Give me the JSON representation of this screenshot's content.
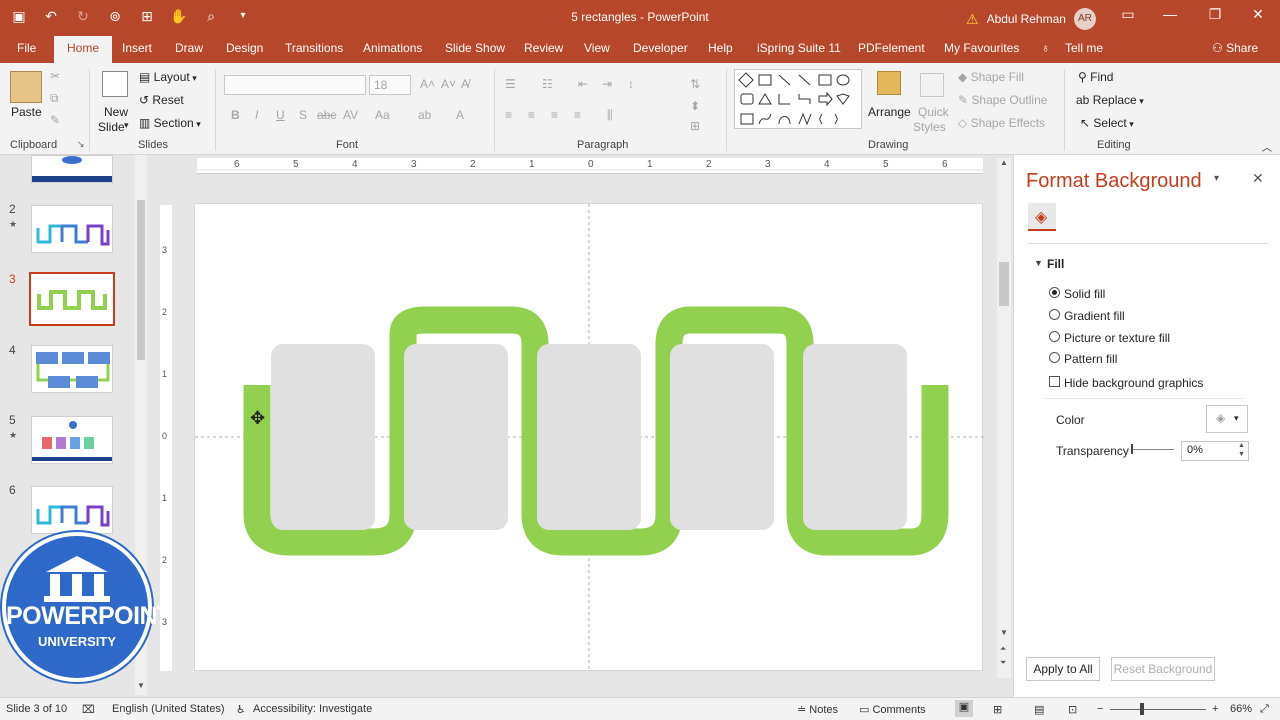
{
  "window": {
    "title": "5 rectangles  -  PowerPoint",
    "user_name": "Abdul Rehman",
    "user_initials": "AR",
    "warning_icon": "warning-icon"
  },
  "tabs": [
    "File",
    "Home",
    "Insert",
    "Draw",
    "Design",
    "Transitions",
    "Animations",
    "Slide Show",
    "Review",
    "View",
    "Developer",
    "Help",
    "iSpring Suite 11",
    "PDFelement",
    "My Favourites",
    "Tell me"
  ],
  "share_label": "Share",
  "ribbon": {
    "clipboard": {
      "paste": "Paste",
      "label": "Clipboard"
    },
    "slides": {
      "new_slide_1": "New",
      "new_slide_2": "Slide",
      "layout": "Layout",
      "reset": "Reset",
      "section": "Section",
      "label": "Slides"
    },
    "font": {
      "size": "18",
      "label": "Font"
    },
    "paragraph": {
      "label": "Paragraph"
    },
    "drawing": {
      "arrange": "Arrange",
      "quick_styles_1": "Quick",
      "quick_styles_2": "Styles",
      "shape_fill": "Shape Fill",
      "shape_outline": "Shape Outline",
      "shape_effects": "Shape Effects",
      "label": "Drawing"
    },
    "editing": {
      "find": "Find",
      "replace": "Replace",
      "select": "Select",
      "label": "Editing"
    }
  },
  "thumbnails": [
    {
      "num": "2",
      "star": "★"
    },
    {
      "num": "3",
      "star": ""
    },
    {
      "num": "4",
      "star": ""
    },
    {
      "num": "5",
      "star": "★"
    },
    {
      "num": "6",
      "star": ""
    }
  ],
  "ruler": {
    "h_ticks": [
      "6",
      "5",
      "4",
      "3",
      "2",
      "1",
      "0",
      "1",
      "2",
      "3",
      "4",
      "5",
      "6"
    ],
    "v_ticks": [
      "3",
      "2",
      "1",
      "0",
      "1",
      "2",
      "3"
    ]
  },
  "format_background": {
    "title": "Format Background",
    "section": "Fill",
    "options": [
      "Solid fill",
      "Gradient fill",
      "Picture or texture fill",
      "Pattern fill"
    ],
    "selected": "Solid fill",
    "hide_graphics": "Hide background graphics",
    "color_label": "Color",
    "transparency_label": "Transparency",
    "transparency_value": "0%",
    "apply_all": "Apply to All",
    "reset_bg": "Reset Background"
  },
  "status": {
    "slide": "Slide 3 of 10",
    "language": "English (United States)",
    "accessibility": "Accessibility: Investigate",
    "notes": "Notes",
    "comments": "Comments",
    "zoom": "66%"
  },
  "watermark": {
    "line1": "POWERPOINT",
    "line2": "UNIVERSITY"
  },
  "colors": {
    "brand": "#b7472a",
    "accent": "#c43e1c",
    "shape_green": "#92d050",
    "shape_gray": "#e0e0e0",
    "logo_blue": "#2e68c8"
  }
}
